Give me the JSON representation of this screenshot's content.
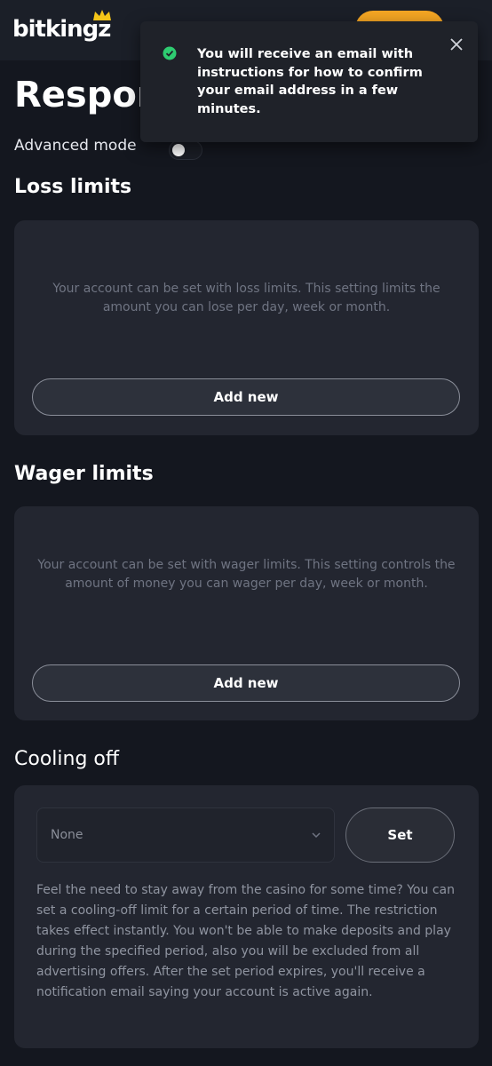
{
  "header": {
    "logo": "bitkingz"
  },
  "page": {
    "title": "Respor"
  },
  "advanced_mode": {
    "label": "Advanced mode",
    "enabled": false
  },
  "loss_limits": {
    "heading": "Loss limits",
    "description": "Your account can be set with loss limits. This setting limits the amount you can lose per day, week or month.",
    "button": "Add new"
  },
  "wager_limits": {
    "heading": "Wager limits",
    "description": "Your account can be set with wager limits. This setting controls the amount of money you can wager per day, week or month.",
    "button": "Add new"
  },
  "cooling_off": {
    "heading": "Cooling off",
    "select_value": "None",
    "button": "Set",
    "description": "Feel the need to stay away from the casino for some time? You can set a cooling-off limit for a certain period of time. The restriction takes effect instantly. You won't be able to make deposits and play during the specified period, also you will be excluded from all advertising offers. After the set period expires, you'll receive a notification email saying your account is active again."
  },
  "toast": {
    "message": "You will receive an email with instructions for how to confirm your email address in a few minutes.",
    "icon": "success-check-icon"
  },
  "colors": {
    "background": "#14171f",
    "card": "#232630",
    "accent": "#f5a623",
    "success": "#2ecc71"
  }
}
